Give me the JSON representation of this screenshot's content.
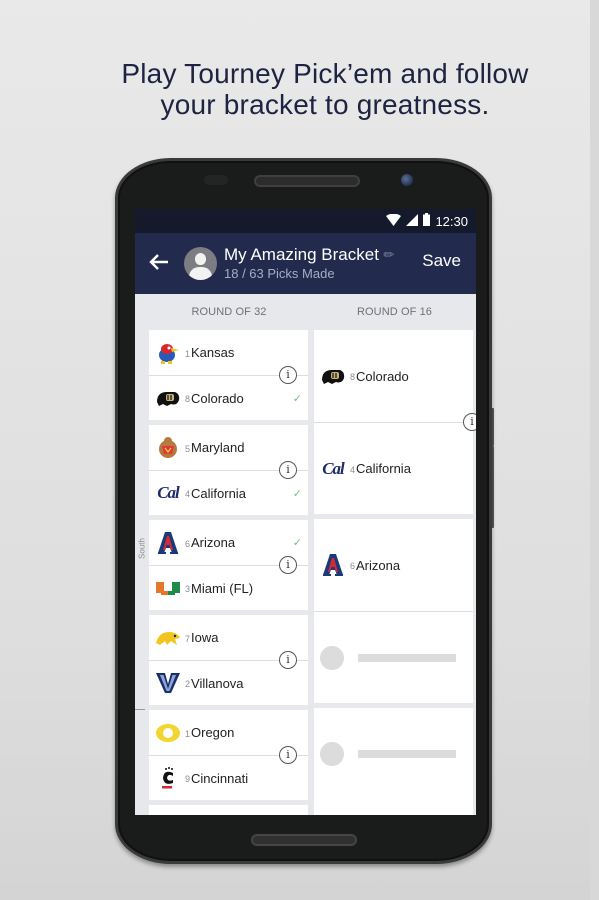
{
  "headline": {
    "line1": "Play Tourney Pick’em and follow",
    "line2": "your bracket to greatness."
  },
  "statusbar": {
    "wifi_icon": "wifi-icon",
    "signal_icon": "cell-signal-icon",
    "battery_icon": "battery-icon",
    "time": "12:30"
  },
  "appbar": {
    "back_icon": "arrow-left-icon",
    "avatar_icon": "user-avatar-icon",
    "title": "My Amazing Bracket",
    "edit_icon": "pencil-icon",
    "subtitle": "18 / 63 Picks Made",
    "save_label": "Save"
  },
  "rounds": {
    "round_of_32": "ROUND OF 32",
    "round_of_16": "ROUND OF 16"
  },
  "region": "South",
  "round_of_32": [
    {
      "teams": [
        {
          "seed": "1",
          "name": "Kansas",
          "logo": "kansas-jayhawk-logo",
          "picked": false
        },
        {
          "seed": "8",
          "name": "Colorado",
          "logo": "colorado-buffalo-logo",
          "picked": true
        }
      ]
    },
    {
      "teams": [
        {
          "seed": "5",
          "name": "Maryland",
          "logo": "maryland-terrapin-logo",
          "picked": false
        },
        {
          "seed": "4",
          "name": "California",
          "logo": "cal-logo",
          "picked": true
        }
      ]
    },
    {
      "teams": [
        {
          "seed": "6",
          "name": "Arizona",
          "logo": "arizona-a-logo",
          "picked": true
        },
        {
          "seed": "3",
          "name": "Miami (FL)",
          "logo": "miami-u-logo",
          "picked": false
        }
      ]
    },
    {
      "teams": [
        {
          "seed": "7",
          "name": "Iowa",
          "logo": "iowa-hawkeye-logo",
          "picked": false
        },
        {
          "seed": "2",
          "name": "Villanova",
          "logo": "villanova-v-logo",
          "picked": false
        }
      ]
    },
    {
      "teams": [
        {
          "seed": "1",
          "name": "Oregon",
          "logo": "oregon-o-logo",
          "picked": false
        },
        {
          "seed": "9",
          "name": "Cincinnati",
          "logo": "cincinnati-c-logo",
          "picked": false
        }
      ]
    }
  ],
  "round_of_16": [
    {
      "slots": [
        {
          "seed": "8",
          "name": "Colorado",
          "logo": "colorado-buffalo-logo"
        },
        {
          "seed": "4",
          "name": "California",
          "logo": "cal-logo"
        }
      ]
    },
    {
      "slots": [
        {
          "seed": "6",
          "name": "Arizona",
          "logo": "arizona-a-logo"
        },
        {
          "seed": "",
          "name": "",
          "logo": "empty-placeholder"
        }
      ]
    },
    {
      "slots": [
        {
          "seed": "",
          "name": "",
          "logo": "empty-placeholder"
        }
      ]
    }
  ],
  "info_icon": "info-icon",
  "check_icon": "checkmark-icon",
  "colors": {
    "appbar": "#222b4d",
    "statusbar": "#141a2c",
    "pick_check": "#6dc58a",
    "headline": "#1d2340"
  }
}
